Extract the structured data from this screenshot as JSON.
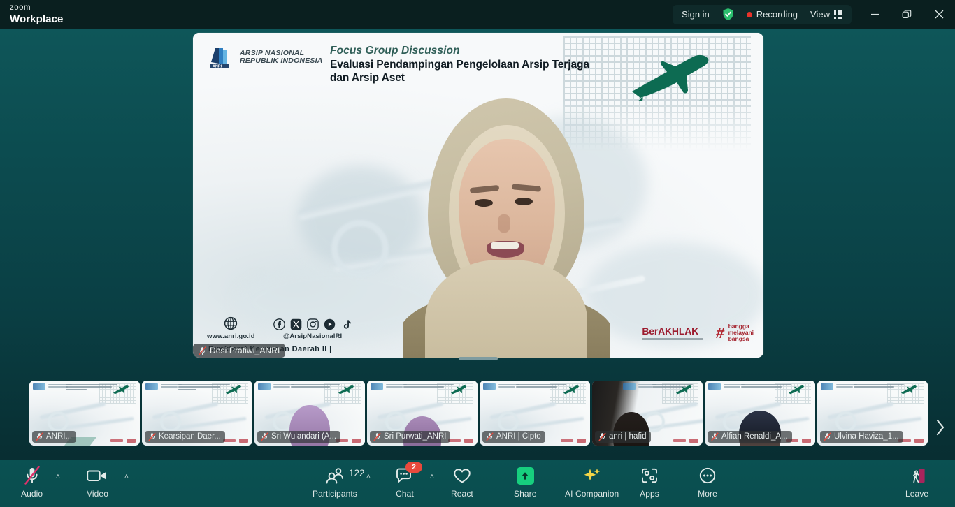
{
  "app": {
    "brand_top": "zoom",
    "brand_bottom": "Workplace"
  },
  "titlebar": {
    "sign_in": "Sign in",
    "shield_icon": "shield-check-icon",
    "recording_label": "Recording",
    "recording_dot": "recording-dot-icon",
    "view_label": "View",
    "view_icon": "grid-icon",
    "minimize_icon": "minimize-icon",
    "restore_icon": "restore-icon",
    "close_icon": "close-icon"
  },
  "main_video": {
    "participant_name": "Desi Pratiwi_ANRI",
    "mic_icon": "mic-off-icon",
    "slide": {
      "org_line1": "ARSIP NASIONAL",
      "org_line2": "REPUBLIK INDONESIA",
      "logo_icon": "anri-logo-icon",
      "eyebrow": "Focus Group Discussion",
      "title_line1": "Evaluasi Pendampingan Pengelolaan Arsip Terjaga",
      "title_line2": "dan Arsip Aset",
      "plane_icon": "airplane-icon",
      "website_icon": "globe-icon",
      "website": "www.anri.go.id",
      "social_icons": [
        "facebook-icon",
        "x-twitter-icon",
        "instagram-icon",
        "youtube-icon",
        "tiktok-icon"
      ],
      "social_handle": "@ArsipNasionalRI",
      "department": "Direktorat Kearsipan Daerah II |",
      "logo_berakhlak_a": "Ber",
      "logo_berakhlak_b": "AKHLAK",
      "logo_bangga_hash": "#",
      "logo_bangga_l1": "bangga",
      "logo_bangga_l2": "melayani",
      "logo_bangga_l3": "bangsa"
    }
  },
  "filmstrip": {
    "next_icon": "chevron-right-icon",
    "thumbnails": [
      {
        "name": "ANRI...",
        "mic_icon": "mic-off-icon",
        "has_person": false
      },
      {
        "name": "Kearsipan Daer...",
        "mic_icon": "mic-off-icon",
        "has_person": false
      },
      {
        "name": "Sri Wulandari (A...",
        "mic_icon": "mic-off-icon",
        "has_person": true
      },
      {
        "name": "Sri Purwati_ANRI",
        "mic_icon": "mic-off-icon",
        "has_person": true
      },
      {
        "name": "ANRI | Cipto",
        "mic_icon": "mic-off-icon",
        "has_person": false
      },
      {
        "name": "anri | hafid",
        "mic_icon": "mic-off-icon",
        "has_person": true
      },
      {
        "name": "Alfian Renaldi_A...",
        "mic_icon": "mic-off-icon",
        "has_person": true
      },
      {
        "name": "Ulvina Haviza_1...",
        "mic_icon": "mic-off-icon",
        "has_person": false
      }
    ]
  },
  "toolbar": {
    "audio": {
      "label": "Audio",
      "icon": "mic-off-icon",
      "caret": "˄"
    },
    "video": {
      "label": "Video",
      "icon": "camera-icon",
      "caret": "˄"
    },
    "participants": {
      "label": "Participants",
      "icon": "people-icon",
      "count": "122",
      "caret": "˄"
    },
    "chat": {
      "label": "Chat",
      "icon": "chat-bubble-icon",
      "badge": "2",
      "caret": "˄"
    },
    "react": {
      "label": "React",
      "icon": "heart-icon"
    },
    "share": {
      "label": "Share",
      "icon": "share-screen-icon"
    },
    "ai_companion": {
      "label": "AI Companion",
      "icon": "sparkle-icon"
    },
    "apps": {
      "label": "Apps",
      "icon": "apps-icon"
    },
    "more": {
      "label": "More",
      "icon": "ellipsis-icon"
    },
    "leave": {
      "label": "Leave",
      "icon": "leave-door-icon"
    }
  },
  "colors": {
    "titlebar_bg": "#0a1f1f",
    "stage_top": "#0e5659",
    "stage_bottom": "#07282c",
    "toolbar_bg": "#0a4f50",
    "accent_green": "#17cf7e",
    "recording_red": "#e8332a",
    "badge_red": "#e8493c",
    "ai_yellow": "#f4d548",
    "leave_red": "#b5275a"
  }
}
